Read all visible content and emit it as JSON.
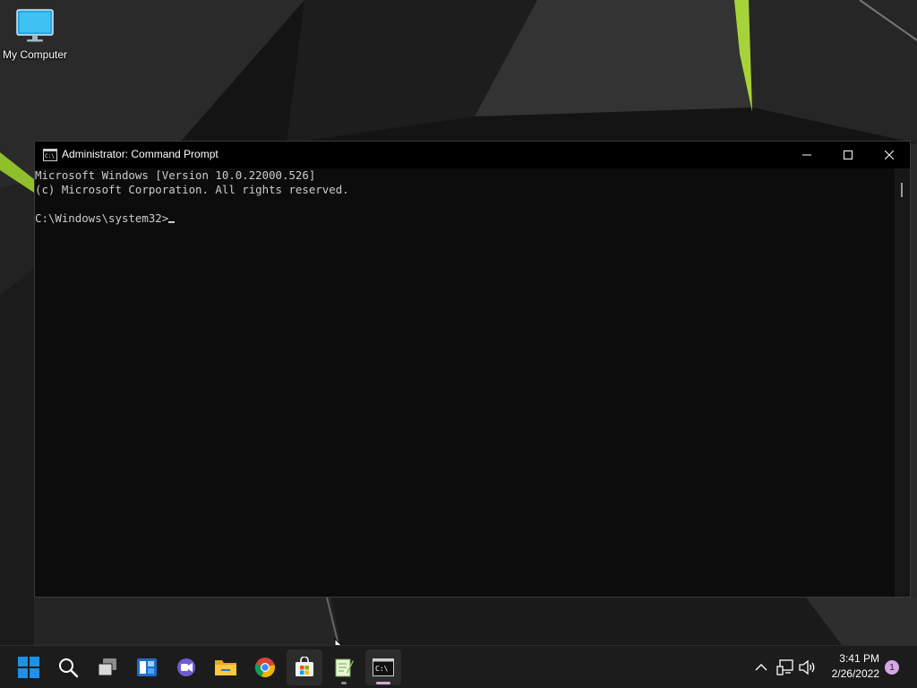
{
  "desktop": {
    "icons": [
      {
        "label": "My Computer",
        "icon": "monitor-icon"
      }
    ]
  },
  "window": {
    "title": "Administrator: Command Prompt",
    "app_icon": "cmd-icon",
    "controls": {
      "minimize": "minimize-icon",
      "maximize": "maximize-icon",
      "close": "close-icon"
    },
    "console": {
      "lines": [
        "Microsoft Windows [Version 10.0.22000.526]",
        "(c) Microsoft Corporation. All rights reserved.",
        ""
      ],
      "prompt": "C:\\Windows\\system32>"
    }
  },
  "taskbar": {
    "items": [
      {
        "name": "start",
        "icon": "windows-start-icon"
      },
      {
        "name": "search",
        "icon": "search-icon"
      },
      {
        "name": "task-view",
        "icon": "task-view-icon"
      },
      {
        "name": "widgets",
        "icon": "widgets-icon"
      },
      {
        "name": "teams-chat",
        "icon": "chat-icon"
      },
      {
        "name": "file-explorer",
        "icon": "folder-icon"
      },
      {
        "name": "chrome",
        "icon": "chrome-icon"
      },
      {
        "name": "microsoft-store",
        "icon": "store-icon"
      },
      {
        "name": "notepad-plus-plus",
        "icon": "notepad-icon"
      },
      {
        "name": "command-prompt",
        "icon": "cmd-icon"
      }
    ],
    "tray": {
      "overflow_icon": "chevron-up-icon",
      "network_icon": "network-icon",
      "volume_icon": "volume-icon",
      "time": "3:41 PM",
      "date": "2/26/2022",
      "notification_count": "1"
    }
  },
  "colors": {
    "console_bg": "#0c0c0c",
    "console_fg": "#cccccc",
    "taskbar_bg": "#1c1c1c",
    "accent_blue": "#1e90e8",
    "badge": "#d4a6e6"
  }
}
